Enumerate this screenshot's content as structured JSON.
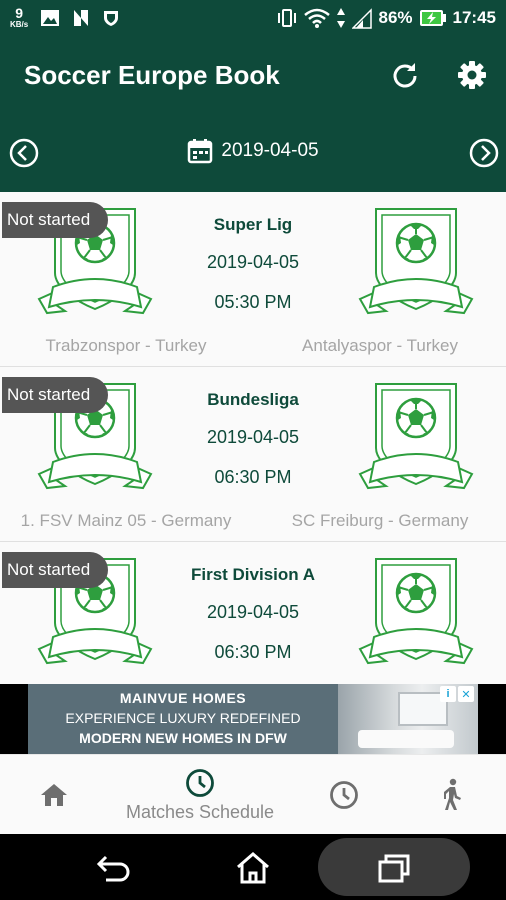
{
  "status_bar": {
    "net_speed_value": "9",
    "net_speed_unit": "KB/s",
    "battery_percent": "86%",
    "time": "17:45",
    "icons": [
      "gallery-icon",
      "n-icon",
      "shield-icon",
      "vibrate-icon",
      "wifi-icon",
      "data-arrows-icon",
      "signal-icon",
      "battery-charging-icon"
    ]
  },
  "app_bar": {
    "title": "Soccer Europe Book",
    "actions": [
      "refresh-icon",
      "settings-icon"
    ]
  },
  "date_bar": {
    "date": "2019-04-05",
    "prev_icon": "chevron-left-circle-icon",
    "next_icon": "chevron-right-circle-icon",
    "calendar_icon": "calendar-icon"
  },
  "matches": [
    {
      "status": "Not started",
      "league": "Super Lig",
      "date": "2019-04-05",
      "time": "05:30 PM",
      "home_team": "Trabzonspor - Turkey",
      "away_team": "Antalyaspor - Turkey"
    },
    {
      "status": "Not started",
      "league": "Bundesliga",
      "date": "2019-04-05",
      "time": "06:30 PM",
      "home_team": "1. FSV Mainz 05 - Germany",
      "away_team": "SC Freiburg - Germany"
    },
    {
      "status": "Not started",
      "league": "First Division A",
      "date": "2019-04-05",
      "time": "06:30 PM",
      "home_team": "",
      "away_team": ""
    }
  ],
  "ad": {
    "brand": "MAINVUE HOMES",
    "line1": "EXPERIENCE LUXURY REDEFINED",
    "line2": "MODERN NEW HOMES IN DFW"
  },
  "bottom_nav": {
    "items": [
      {
        "icon": "home-icon",
        "label": ""
      },
      {
        "icon": "clock-icon",
        "label": "Matches Schedule"
      },
      {
        "icon": "history-clock-icon",
        "label": ""
      },
      {
        "icon": "walking-person-icon",
        "label": ""
      }
    ]
  },
  "colors": {
    "primary": "#0e4a3a",
    "crest_green": "#2e9e3e",
    "badge": "#555555",
    "team_text": "#a5a5a5"
  }
}
